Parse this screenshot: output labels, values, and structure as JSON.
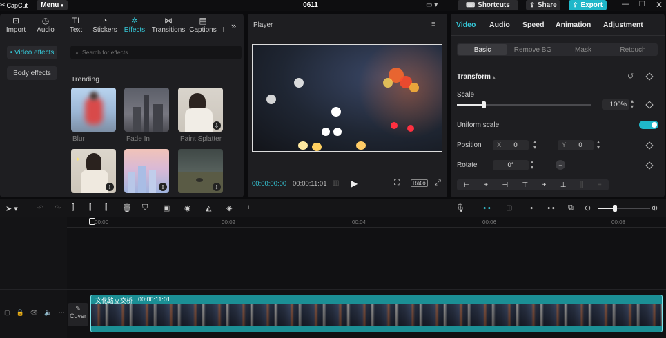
{
  "app": {
    "logo": "CapCut",
    "menu_label": "Menu",
    "title": "0611",
    "shortcuts_label": "Shortcuts",
    "share_label": "Share",
    "export_label": "Export"
  },
  "media_tabs": [
    {
      "label": "Import",
      "icon": "import-icon"
    },
    {
      "label": "Audio",
      "icon": "audio-icon"
    },
    {
      "label": "Text",
      "icon": "text-icon"
    },
    {
      "label": "Stickers",
      "icon": "stickers-icon"
    },
    {
      "label": "Effects",
      "icon": "effects-icon",
      "active": true
    },
    {
      "label": "Transitions",
      "icon": "transitions-icon"
    },
    {
      "label": "Captions",
      "icon": "captions-icon"
    },
    {
      "label": "I",
      "icon": ""
    }
  ],
  "effects_panel": {
    "categories": [
      "• Video effects",
      "Body effects"
    ],
    "search_placeholder": "Search for effects",
    "section_title": "Trending",
    "effects": [
      {
        "name": "Blur"
      },
      {
        "name": "Fade In"
      },
      {
        "name": "Paint Splatter"
      },
      {
        "name": ""
      },
      {
        "name": ""
      },
      {
        "name": ""
      }
    ]
  },
  "player": {
    "title": "Player",
    "current_time": "00:00:00:00",
    "total_time": "00:00:11:01",
    "ratio_label": "Ratio"
  },
  "props": {
    "tabs": [
      "Video",
      "Audio",
      "Speed",
      "Animation",
      "Adjustment"
    ],
    "subtabs": [
      "Basic",
      "Remove BG",
      "Mask",
      "Retouch"
    ],
    "transform_label": "Transform",
    "scale_label": "Scale",
    "scale_value": "100%",
    "scale_level": 0.2,
    "uniform_label": "Uniform scale",
    "uniform_on": true,
    "position_label": "Position",
    "pos_x_label": "X",
    "pos_x": "0",
    "pos_y_label": "Y",
    "pos_y": "0",
    "rotate_label": "Rotate",
    "rotate_value": "0°"
  },
  "timeline": {
    "ruler": [
      "00:00",
      "00:02",
      "00:04",
      "00:06",
      "00:08"
    ],
    "clip_title": "文化路立交桥",
    "clip_duration": "00:00:11:01",
    "cover_label": "Cover"
  },
  "colors": {
    "accent": "#35c8d8",
    "clip": "#1b8f95"
  }
}
